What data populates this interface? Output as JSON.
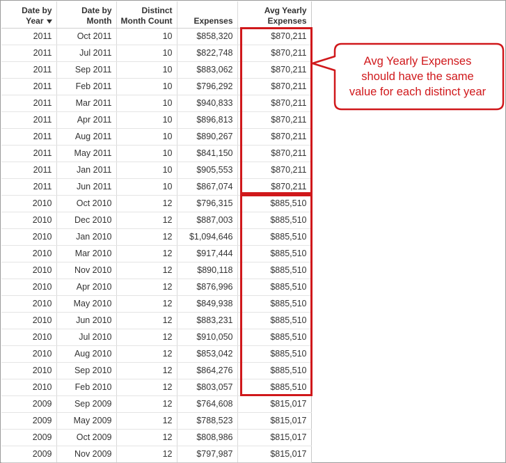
{
  "table": {
    "headers": [
      [
        "Date by",
        "Year"
      ],
      [
        "Date by",
        "Month"
      ],
      [
        "Distinct",
        "Month Count"
      ],
      [
        "Expenses"
      ],
      [
        "Avg Yearly",
        "Expenses"
      ]
    ],
    "sort_indicator": "sort-descending-icon",
    "rows": [
      [
        "2011",
        "Oct 2011",
        "10",
        "$858,320",
        "$870,211"
      ],
      [
        "2011",
        "Jul 2011",
        "10",
        "$822,748",
        "$870,211"
      ],
      [
        "2011",
        "Sep 2011",
        "10",
        "$883,062",
        "$870,211"
      ],
      [
        "2011",
        "Feb 2011",
        "10",
        "$796,292",
        "$870,211"
      ],
      [
        "2011",
        "Mar 2011",
        "10",
        "$940,833",
        "$870,211"
      ],
      [
        "2011",
        "Apr 2011",
        "10",
        "$896,813",
        "$870,211"
      ],
      [
        "2011",
        "Aug 2011",
        "10",
        "$890,267",
        "$870,211"
      ],
      [
        "2011",
        "May 2011",
        "10",
        "$841,150",
        "$870,211"
      ],
      [
        "2011",
        "Jan 2011",
        "10",
        "$905,553",
        "$870,211"
      ],
      [
        "2011",
        "Jun 2011",
        "10",
        "$867,074",
        "$870,211"
      ],
      [
        "2010",
        "Oct 2010",
        "12",
        "$796,315",
        "$885,510"
      ],
      [
        "2010",
        "Dec 2010",
        "12",
        "$887,003",
        "$885,510"
      ],
      [
        "2010",
        "Jan 2010",
        "12",
        "$1,094,646",
        "$885,510"
      ],
      [
        "2010",
        "Mar 2010",
        "12",
        "$917,444",
        "$885,510"
      ],
      [
        "2010",
        "Nov 2010",
        "12",
        "$890,118",
        "$885,510"
      ],
      [
        "2010",
        "Apr 2010",
        "12",
        "$876,996",
        "$885,510"
      ],
      [
        "2010",
        "May 2010",
        "12",
        "$849,938",
        "$885,510"
      ],
      [
        "2010",
        "Jun 2010",
        "12",
        "$883,231",
        "$885,510"
      ],
      [
        "2010",
        "Jul 2010",
        "12",
        "$910,050",
        "$885,510"
      ],
      [
        "2010",
        "Aug 2010",
        "12",
        "$853,042",
        "$885,510"
      ],
      [
        "2010",
        "Sep 2010",
        "12",
        "$864,276",
        "$885,510"
      ],
      [
        "2010",
        "Feb 2010",
        "12",
        "$803,057",
        "$885,510"
      ],
      [
        "2009",
        "Sep 2009",
        "12",
        "$764,608",
        "$815,017"
      ],
      [
        "2009",
        "May 2009",
        "12",
        "$788,523",
        "$815,017"
      ],
      [
        "2009",
        "Oct 2009",
        "12",
        "$808,986",
        "$815,017"
      ],
      [
        "2009",
        "Nov 2009",
        "12",
        "$797,987",
        "$815,017"
      ]
    ]
  },
  "callout": {
    "lines": [
      "Avg Yearly Expenses",
      "should have the same",
      "value for each distinct year"
    ]
  },
  "colors": {
    "annotation_red": "#d0181b",
    "text": "#333333",
    "grid": "#d9d9d9"
  }
}
